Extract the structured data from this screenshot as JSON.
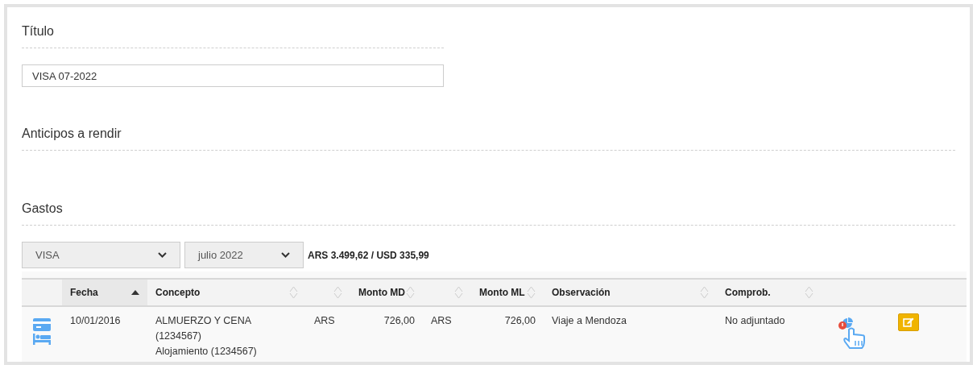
{
  "sections": [
    {
      "title": "Título"
    },
    {
      "title": "Anticipos a rendir"
    },
    {
      "title": "Gastos"
    }
  ],
  "title_field": {
    "value": "VISA 07-2022"
  },
  "filters": [
    {
      "value": "VISA"
    },
    {
      "value": "julio 2022"
    }
  ],
  "total": "ARS 3.499,62 / USD 335,99",
  "table": {
    "columns": [
      {
        "label": "Fecha",
        "sorted": true
      },
      {
        "label": "Concepto",
        "sorted": false
      },
      {
        "sorted": false
      },
      {
        "label": "Monto MD",
        "sorted": false
      },
      {
        "sorted": false
      },
      {
        "label": "Monto ML",
        "sorted": false
      },
      {
        "label": "Observación",
        "sorted": false
      },
      {
        "label": "Comprob.",
        "sorted": false
      }
    ],
    "rows": [
      {
        "fecha": "10/01/2016",
        "concepto": [
          "ALMUERZO Y CENA (1234567)",
          "Alojamiento (1234567)"
        ],
        "moneda_md": "ARS",
        "monto_md": "726,00",
        "moneda_ml": "ARS",
        "monto_ml": "726,00",
        "observacion": "Viaje a Mendoza",
        "comprobante": "No adjuntado",
        "warning": true
      }
    ]
  }
}
